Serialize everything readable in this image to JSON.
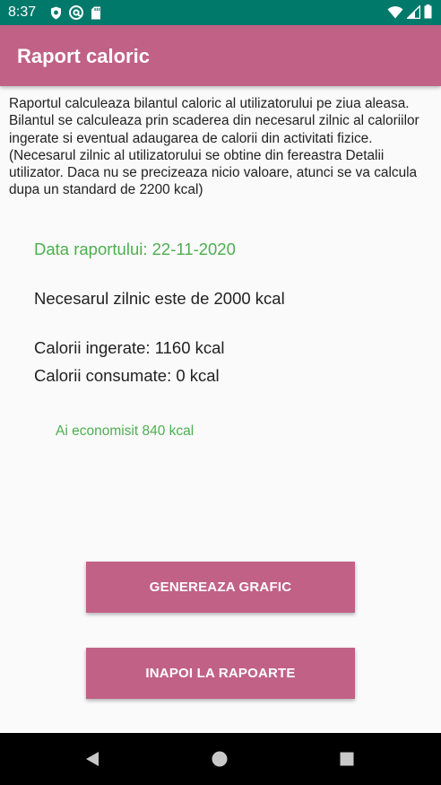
{
  "status_bar": {
    "time": "8:37",
    "left_icons": [
      "shield-icon",
      "at-circle-icon",
      "sd-card-icon"
    ],
    "right_icons": [
      "wifi-icon",
      "signal-icon",
      "battery-icon"
    ],
    "background": "#00796b"
  },
  "app_bar": {
    "title": "Raport caloric",
    "color": "#c16185"
  },
  "report": {
    "description": "Raportul calculeaza bilantul caloric al utilizatorului pe ziua aleasa. Bilantul se calculeaza prin scaderea din necesarul zilnic al caloriilor ingerate si eventual adaugarea de calorii din activitati fizice. (Necesarul zilnic al utilizatorului se obtine din fereastra Detalii utilizator. Daca nu se precizeaza nicio valoare, atunci se va calcula dupa un standard de 2200 kcal)",
    "date_text": "Data raportului: 22-11-2020",
    "daily_need_text": "Necesarul zilnic este de 2000 kcal",
    "calories_in_text": "Calorii ingerate: 1160 kcal",
    "calories_out_text": "Calorii consumate: 0 kcal",
    "savings_text": "Ai economisit 840 kcal",
    "accent_green": "#4caf50"
  },
  "buttons": {
    "generate_chart": "GENEREAZA GRAFIC",
    "back_to_reports": "INAPOI LA RAPOARTE"
  },
  "nav_bar": {
    "icons": [
      "back-triangle-icon",
      "home-circle-icon",
      "recents-square-icon"
    ]
  }
}
